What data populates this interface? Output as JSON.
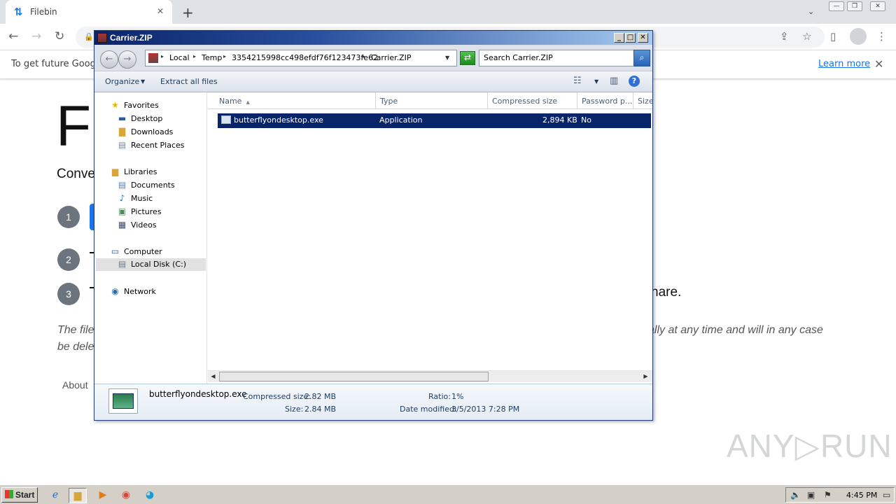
{
  "browser": {
    "tab_title": "Filebin",
    "infobar_text": "To get future Google",
    "learn_more": "Learn more"
  },
  "page": {
    "heading_fragment": "Fi",
    "subheading_fragment": "Conve",
    "steps": [
      "1",
      "2",
      "3"
    ],
    "share_fragment": "hare.",
    "italic_line1_left": "The file",
    "italic_line1_right": "ally at any time and will in any case",
    "italic_line2_left": "be dele",
    "about": "About",
    "watermark": "ANY▷RUN"
  },
  "zip_window": {
    "title": "Carrier.ZIP",
    "breadcrumbs": [
      "Local",
      "Temp",
      "3354215998cc498efdf76f123473fe62",
      "Carrier.ZIP"
    ],
    "search_placeholder": "Search Carrier.ZIP",
    "commands": {
      "organize": "Organize",
      "extract": "Extract all files"
    },
    "nav": {
      "favorites": "Favorites",
      "desktop": "Desktop",
      "downloads": "Downloads",
      "recent_places": "Recent Places",
      "libraries": "Libraries",
      "documents": "Documents",
      "music": "Music",
      "pictures": "Pictures",
      "videos": "Videos",
      "computer": "Computer",
      "local_disk": "Local Disk (C:)",
      "network": "Network"
    },
    "columns": [
      "Name",
      "Type",
      "Compressed size",
      "Password p...",
      "Size"
    ],
    "files": [
      {
        "name": "butterflyondesktop.exe",
        "type": "Application",
        "compressed_size": "2,894 KB",
        "password": "No"
      }
    ],
    "details": {
      "filename": "butterflyondesktop.exe",
      "compressed_label": "Compressed size:",
      "compressed_value": "2.82 MB",
      "size_label": "Size:",
      "size_value": "2.84 MB",
      "ratio_label": "Ratio:",
      "ratio_value": "1%",
      "modified_label": "Date modified:",
      "modified_value": "3/5/2013 7:28 PM"
    }
  },
  "taskbar": {
    "start": "Start",
    "clock": "4:45 PM"
  },
  "colors": {
    "selection": "#0a246a",
    "chrome_tabstrip": "#dee1e6",
    "link": "#1a73e8",
    "taskbar": "#d4d0c8"
  }
}
